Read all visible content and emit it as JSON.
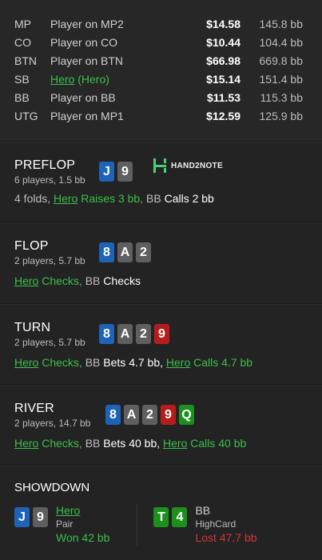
{
  "players": [
    {
      "pos": "MP",
      "name": "Player on MP2",
      "stack": "$14.58",
      "bb": "145.8 bb",
      "hero": false
    },
    {
      "pos": "CO",
      "name": "Player on CO",
      "stack": "$10.44",
      "bb": "104.4 bb",
      "hero": false
    },
    {
      "pos": "BTN",
      "name": "Player on BTN",
      "stack": "$66.98",
      "bb": "669.8 bb",
      "hero": false
    },
    {
      "pos": "SB",
      "name_link": "Hero",
      "name_suffix": " (Hero)",
      "stack": "$15.14",
      "bb": "151.4 bb",
      "hero": true
    },
    {
      "pos": "BB",
      "name": "Player on BB",
      "stack": "$11.53",
      "bb": "115.3 bb",
      "hero": false
    },
    {
      "pos": "UTG",
      "name": "Player on MP1",
      "stack": "$12.59",
      "bb": "125.9 bb",
      "hero": false
    }
  ],
  "logo": {
    "text": "HAND2NOTE"
  },
  "preflop": {
    "name": "PREFLOP",
    "sub": "6 players, 1.5 bb",
    "cards": [
      "J",
      "9"
    ],
    "action": {
      "a1": "4 folds, ",
      "a2": "Hero",
      "a3": " Raises 3 bb, ",
      "a4": "BB ",
      "a5": "Calls 2 bb"
    }
  },
  "flop": {
    "name": "FLOP",
    "sub": "2 players, 5.7 bb",
    "cards": [
      "8",
      "A",
      "2"
    ],
    "action": {
      "a1": "Hero",
      "a2": " Checks, ",
      "a3": "BB ",
      "a4": "Checks"
    }
  },
  "turn": {
    "name": "TURN",
    "sub": "2 players, 5.7 bb",
    "cards": [
      "8",
      "A",
      "2",
      "9"
    ],
    "action": {
      "a1": "Hero",
      "a2": " Checks, ",
      "a3": "BB ",
      "a4": "Bets 4.7 bb, ",
      "a5": "Hero",
      "a6": " Calls 4.7 bb"
    }
  },
  "river": {
    "name": "RIVER",
    "sub": "2 players, 14.7 bb",
    "cards": [
      "8",
      "A",
      "2",
      "9",
      "Q"
    ],
    "action": {
      "a1": "Hero",
      "a2": " Checks, ",
      "a3": "BB ",
      "a4": "Bets 40 bb, ",
      "a5": "Hero",
      "a6": " Calls 40 bb"
    }
  },
  "showdown": {
    "title": "SHOWDOWN",
    "hero": {
      "cards": [
        "J",
        "9"
      ],
      "name": "Hero",
      "hand": "Pair",
      "result": "Won 42 bb"
    },
    "villain": {
      "cards": [
        "T",
        "4"
      ],
      "name": "BB",
      "hand": "HighCard",
      "result": "Lost 47.7 bb"
    }
  },
  "colors": {
    "blue": "#1e63b8",
    "grey": "#5f5f5f",
    "red": "#b51d1d",
    "green": "#1d8f1d",
    "accent_green": "#3cbf4a",
    "loss_red": "#d43535"
  }
}
